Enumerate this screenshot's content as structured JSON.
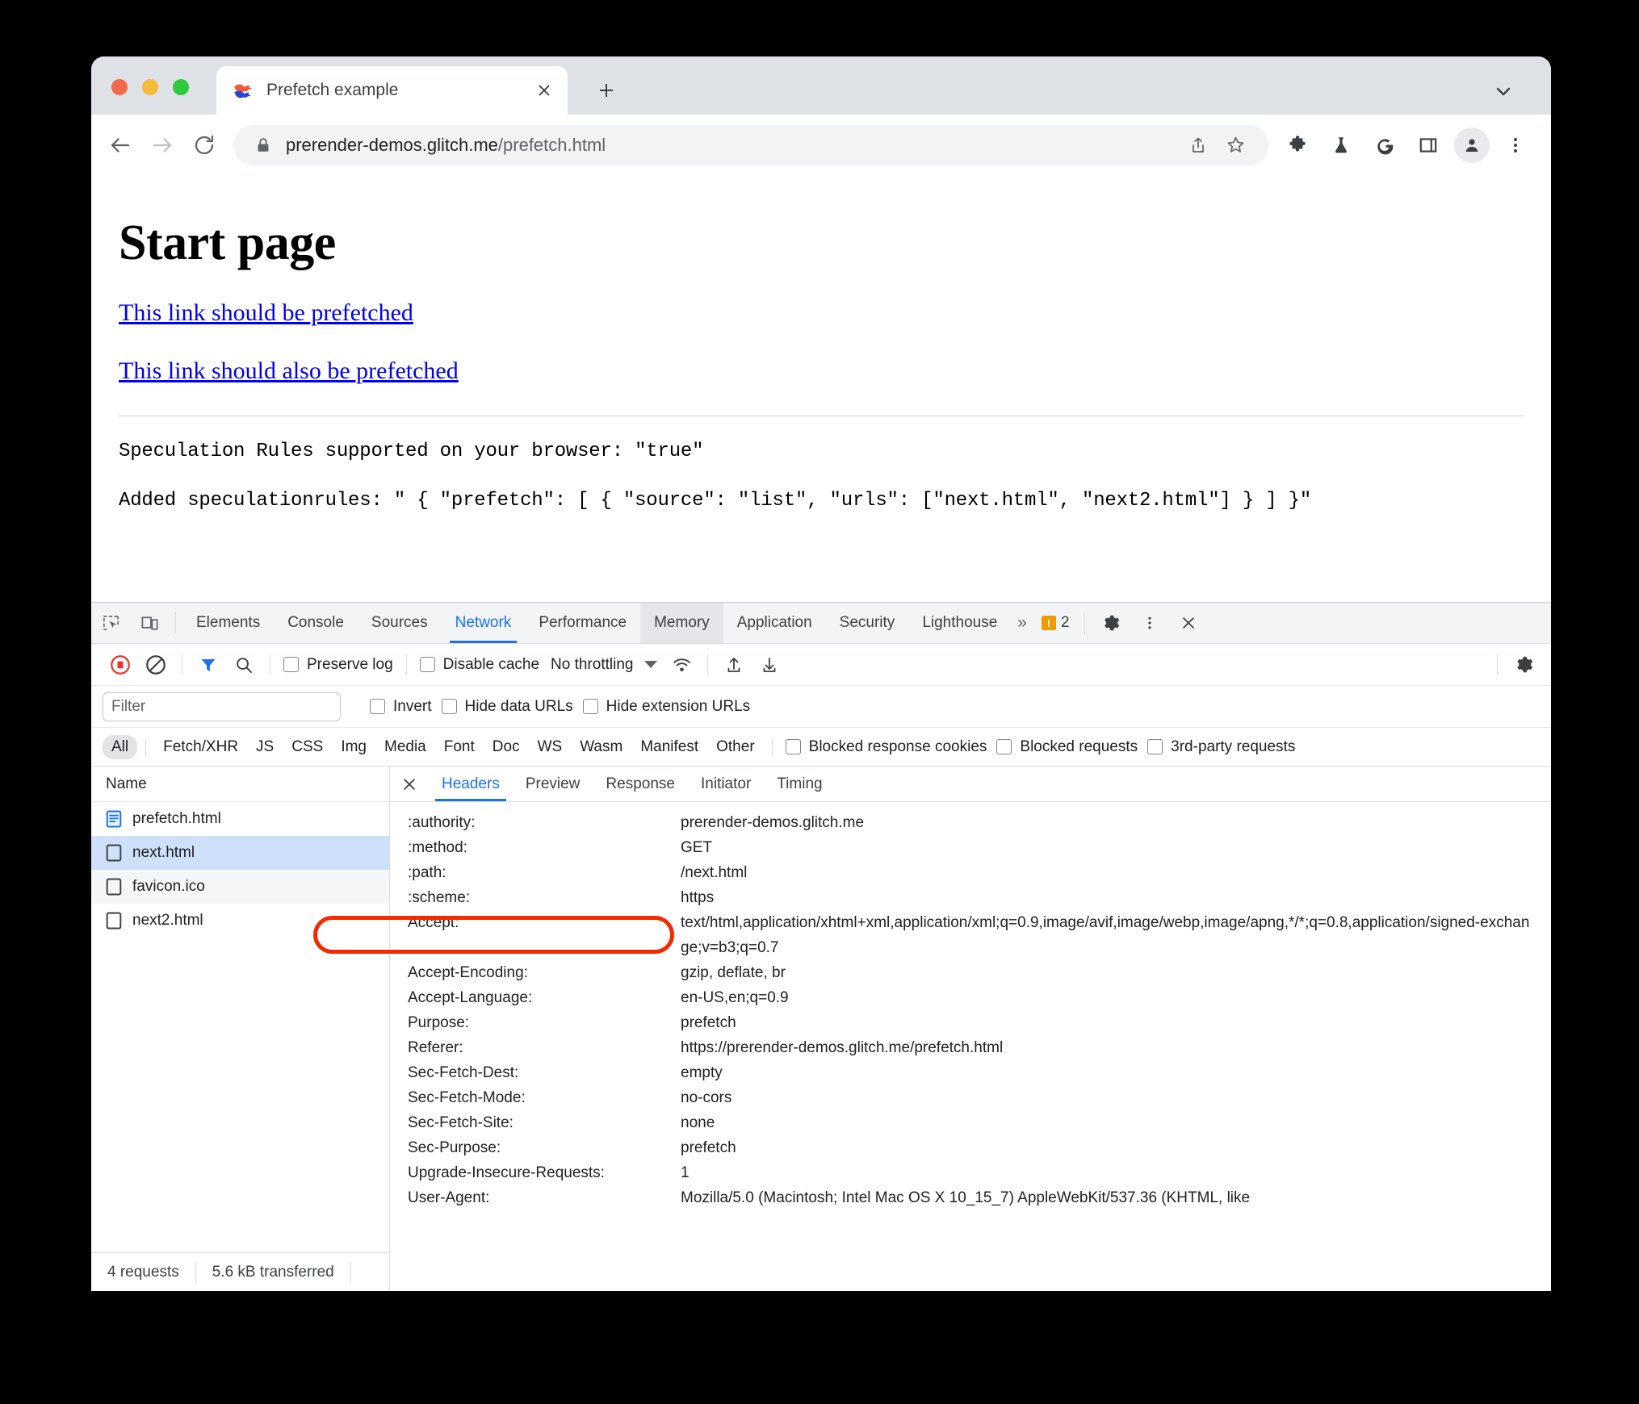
{
  "browser": {
    "tab": {
      "title": "Prefetch example",
      "favicon": "fish-icon",
      "close_label": "×"
    },
    "new_tab_label": "+",
    "omnibox": {
      "host": "prerender-demos.glitch.me",
      "path": "/prefetch.html",
      "lock_icon": "lock-icon"
    },
    "toolbar_icons": [
      "share-icon",
      "star-icon",
      "extensions-puzzle-icon",
      "flask-icon",
      "grammarly-g-icon",
      "side-panel-icon",
      "profile-avatar-icon",
      "three-dot-menu-icon"
    ],
    "nav_icons": [
      "back-arrow-icon",
      "forward-arrow-icon",
      "reload-icon"
    ],
    "tabstrip_chevron": "chevron-down-icon"
  },
  "page": {
    "title": "Start page",
    "links": [
      "This link should be prefetched",
      "This link should also be prefetched"
    ],
    "console_lines": [
      "Speculation Rules supported on your browser: \"true\"",
      "Added speculationrules: \" { \"prefetch\": [ { \"source\": \"list\", \"urls\": [\"next.html\", \"next2.html\"] } ] }\""
    ]
  },
  "devtools": {
    "left_icons": [
      "inspect-element-icon",
      "device-toolbar-icon"
    ],
    "tabs": [
      {
        "label": "Elements",
        "state": "normal"
      },
      {
        "label": "Console",
        "state": "normal"
      },
      {
        "label": "Sources",
        "state": "normal"
      },
      {
        "label": "Network",
        "state": "active"
      },
      {
        "label": "Performance",
        "state": "normal"
      },
      {
        "label": "Memory",
        "state": "hovered"
      },
      {
        "label": "Application",
        "state": "normal"
      },
      {
        "label": "Security",
        "state": "normal"
      },
      {
        "label": "Lighthouse",
        "state": "normal"
      }
    ],
    "more_tabs_label": "»",
    "warning_count": "2",
    "warning_badge_char": "!",
    "right_icons": [
      "settings-gear-icon",
      "three-dot-menu-icon",
      "close-devtools-icon"
    ],
    "network_toolbar": {
      "record_icon": "record-stop-icon",
      "clear_icon": "clear-icon",
      "filter_icon": "filter-funnel-icon",
      "search_icon": "search-icon",
      "preserve_log": "Preserve log",
      "disable_cache": "Disable cache",
      "throttling": "No throttling",
      "wifi_icon": "network-conditions-icon",
      "import_icon": "upload-har-icon",
      "export_icon": "download-har-icon",
      "settings_icon": "settings-gear-icon"
    },
    "filter_bar": {
      "placeholder": "Filter",
      "value": "",
      "invert": "Invert",
      "hide_data_urls": "Hide data URLs",
      "hide_extension_urls": "Hide extension URLs"
    },
    "type_filters": [
      {
        "label": "All",
        "active": true
      },
      {
        "label": "Fetch/XHR",
        "active": false
      },
      {
        "label": "JS",
        "active": false
      },
      {
        "label": "CSS",
        "active": false
      },
      {
        "label": "Img",
        "active": false
      },
      {
        "label": "Media",
        "active": false
      },
      {
        "label": "Font",
        "active": false
      },
      {
        "label": "Doc",
        "active": false
      },
      {
        "label": "WS",
        "active": false
      },
      {
        "label": "Wasm",
        "active": false
      },
      {
        "label": "Manifest",
        "active": false
      },
      {
        "label": "Other",
        "active": false
      }
    ],
    "type_checkboxes": [
      "Blocked response cookies",
      "Blocked requests",
      "3rd-party requests"
    ],
    "request_list": {
      "column_header": "Name",
      "rows": [
        {
          "name": "prefetch.html",
          "icon": "document-icon",
          "selected": false
        },
        {
          "name": "next.html",
          "icon": "generic-file-icon",
          "selected": true
        },
        {
          "name": "favicon.ico",
          "icon": "generic-file-icon",
          "selected": false
        },
        {
          "name": "next2.html",
          "icon": "generic-file-icon",
          "selected": false
        }
      ],
      "footer": {
        "requests": "4 requests",
        "transferred": "5.6 kB transferred"
      }
    },
    "detail_tabs": [
      {
        "label": "Headers",
        "active": true
      },
      {
        "label": "Preview",
        "active": false
      },
      {
        "label": "Response",
        "active": false
      },
      {
        "label": "Initiator",
        "active": false
      },
      {
        "label": "Timing",
        "active": false
      }
    ],
    "headers": [
      {
        "name": ":authority:",
        "value": "prerender-demos.glitch.me"
      },
      {
        "name": ":method:",
        "value": "GET"
      },
      {
        "name": ":path:",
        "value": "/next.html"
      },
      {
        "name": ":scheme:",
        "value": "https"
      },
      {
        "name": "Accept:",
        "value": "text/html,application/xhtml+xml,application/xml;q=0.9,image/avif,image/webp,image/apng,*/*;q=0.8,application/signed-exchange;v=b3;q=0.7"
      },
      {
        "name": "Accept-Encoding:",
        "value": "gzip, deflate, br"
      },
      {
        "name": "Accept-Language:",
        "value": "en-US,en;q=0.9"
      },
      {
        "name": "Purpose:",
        "value": "prefetch"
      },
      {
        "name": "Referer:",
        "value": "https://prerender-demos.glitch.me/prefetch.html"
      },
      {
        "name": "Sec-Fetch-Dest:",
        "value": "empty"
      },
      {
        "name": "Sec-Fetch-Mode:",
        "value": "no-cors"
      },
      {
        "name": "Sec-Fetch-Site:",
        "value": "none"
      },
      {
        "name": "Sec-Purpose:",
        "value": "prefetch"
      },
      {
        "name": "Upgrade-Insecure-Requests:",
        "value": "1"
      },
      {
        "name": "User-Agent:",
        "value": "Mozilla/5.0 (Macintosh; Intel Mac OS X 10_15_7) AppleWebKit/537.36 (KHTML, like"
      }
    ]
  },
  "annotation": {
    "target": "Sec-Purpose: prefetch",
    "color": "#f42a00",
    "shape": "oval-outline"
  }
}
